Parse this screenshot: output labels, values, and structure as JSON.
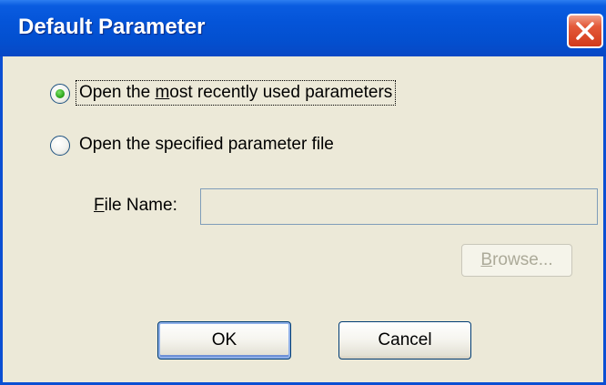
{
  "window": {
    "title": "Default Parameter"
  },
  "options": [
    {
      "pre": "Open the ",
      "u": "m",
      "post": "ost recently used parameters",
      "selected": true
    },
    {
      "pre": "",
      "u": "",
      "post": "Open the specified parameter file",
      "selected": false
    }
  ],
  "file_field": {
    "label_u": "F",
    "label_rest": "ile Name:",
    "value": "",
    "placeholder": ""
  },
  "buttons": {
    "browse_u": "B",
    "browse_rest": "rowse...",
    "ok": "OK",
    "cancel": "Cancel"
  },
  "icons": {
    "close": "close-icon"
  },
  "colors": {
    "title_bar": "#0454d8",
    "close_button": "#d23a1a",
    "dialog_bg": "#ece9d8",
    "radio_dot": "#2fa81e"
  }
}
